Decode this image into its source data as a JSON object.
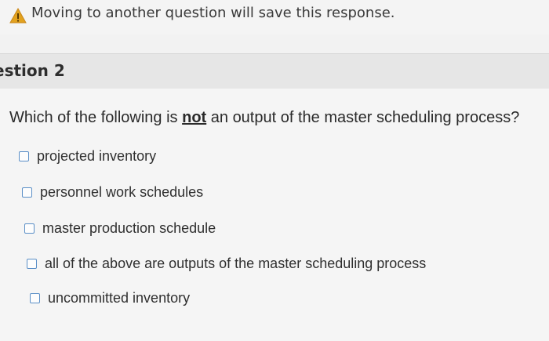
{
  "warning": {
    "icon": "warning-icon",
    "text": "Moving to another question will save this response."
  },
  "question": {
    "title": "estion 2",
    "text_before": "Which of the following is ",
    "text_emphasis": "not",
    "text_after": " an output of the master scheduling process?",
    "options": [
      {
        "label": "projected inventory",
        "checked": false
      },
      {
        "label": "personnel work schedules",
        "checked": false
      },
      {
        "label": "master production schedule",
        "checked": false
      },
      {
        "label": "all of the above are outputs of the master scheduling process",
        "checked": false
      },
      {
        "label": "uncommitted inventory",
        "checked": false
      }
    ]
  },
  "colors": {
    "checkbox_border": "#5b8fc7",
    "warning_icon": "#e2a21e"
  }
}
